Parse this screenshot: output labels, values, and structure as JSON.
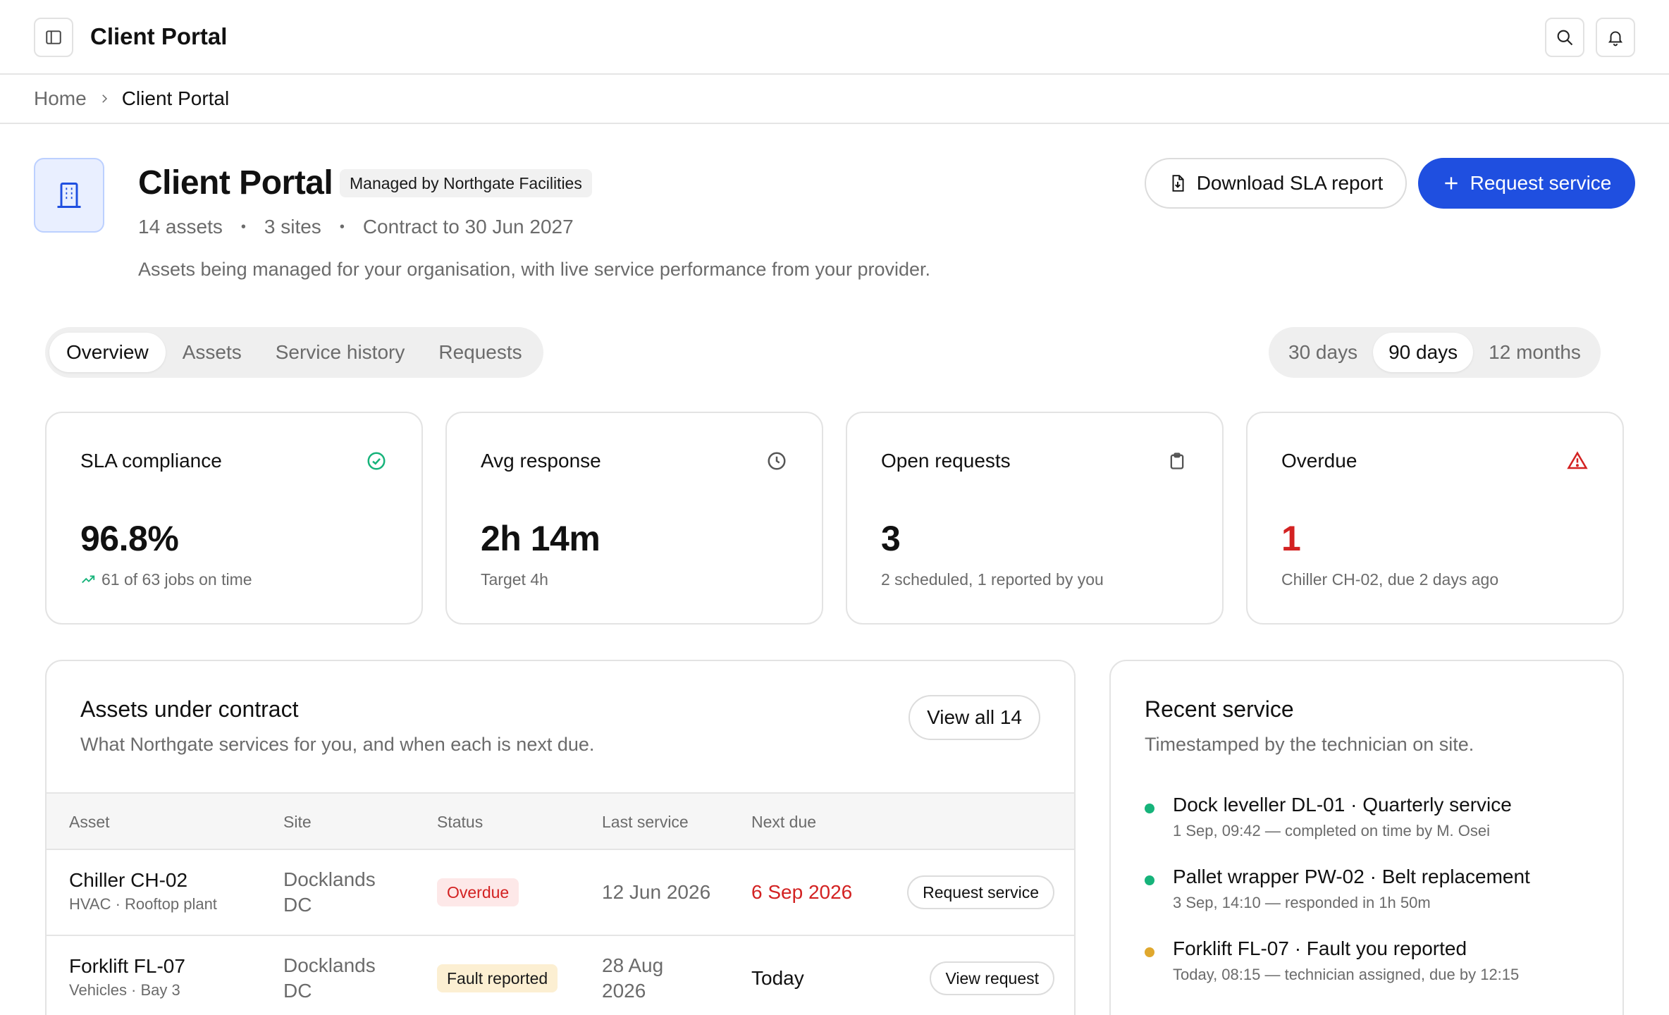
{
  "app": {
    "title": "Client Portal"
  },
  "breadcrumb": {
    "home": "Home",
    "current": "Client Portal"
  },
  "header": {
    "title": "Client Portal",
    "badge": "Managed by Northgate Facilities",
    "meta": [
      "14 assets",
      "3 sites",
      "Contract to 30 Jun 2027"
    ],
    "description": "Assets being managed for your organisation, with live service performance from your provider.",
    "download_label": "Download SLA report",
    "request_label": "Request service"
  },
  "tabs": [
    "Overview",
    "Assets",
    "Service history",
    "Requests"
  ],
  "ranges": [
    "30 days",
    "90 days",
    "12 months"
  ],
  "kpis": [
    {
      "label": "SLA compliance",
      "value": "96.8%",
      "sub": "61 of 63 jobs on time",
      "icon": "check-circle-icon"
    },
    {
      "label": "Avg response",
      "value": "2h 14m",
      "sub": "Target 4h",
      "icon": "clock-icon"
    },
    {
      "label": "Open requests",
      "value": "3",
      "sub": "2 scheduled, 1 reported by you",
      "icon": "clipboard-icon"
    },
    {
      "label": "Overdue",
      "value": "1",
      "sub": "Chiller CH-02, due 2 days ago",
      "icon": "warning-icon"
    }
  ],
  "assets": {
    "title": "Assets under contract",
    "subtitle": "What Northgate services for you, and when each is next due.",
    "view_all": "View all 14",
    "columns": [
      "Asset",
      "Site",
      "Status",
      "Last service",
      "Next due"
    ],
    "rows": [
      {
        "name": "Chiller CH-02",
        "type": "HVAC · Rooftop plant",
        "site": "Docklands DC",
        "status": "Overdue",
        "last": "12 Jun 2026",
        "next": "6 Sep 2026",
        "action": "Request service"
      },
      {
        "name": "Forklift FL-07",
        "type": "Vehicles · Bay 3",
        "site": "Docklands DC",
        "status": "Fault reported",
        "last": "28 Aug 2026",
        "next": "Today",
        "action": "View request"
      }
    ]
  },
  "recent": {
    "title": "Recent service",
    "subtitle": "Timestamped by the technician on site.",
    "items": [
      {
        "title": "Dock leveller DL-01 · Quarterly service",
        "meta": "1 Sep, 09:42 — completed on time by M. Osei"
      },
      {
        "title": "Pallet wrapper PW-02 · Belt replacement",
        "meta": "3 Sep, 14:10 — responded in 1h 50m"
      },
      {
        "title": "Forklift FL-07 · Fault you reported",
        "meta": "Today, 08:15 — technician assigned, due by 12:15"
      }
    ]
  },
  "colors": {
    "accent": "#1f4fe0",
    "success": "#16b37a",
    "danger": "#d32222",
    "warning": "#e0a82e"
  }
}
